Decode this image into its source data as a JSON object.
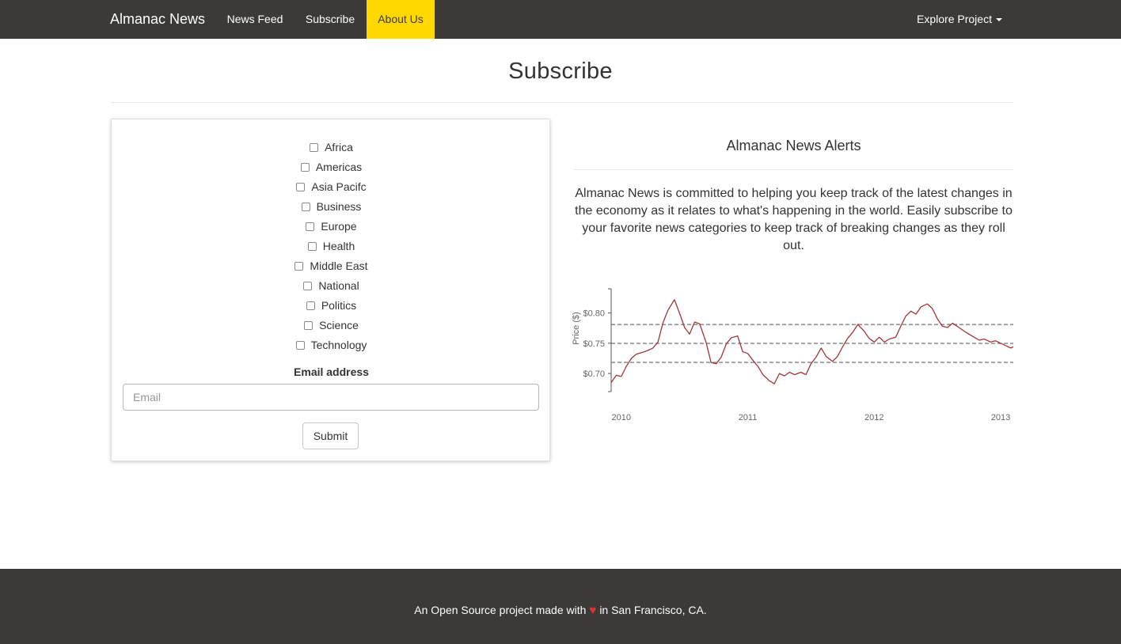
{
  "navbar": {
    "brand": "Almanac News",
    "links": [
      "News Feed",
      "Subscribe",
      "About Us"
    ],
    "explore": "Explore Project",
    "active_color": "#ffd800",
    "bg_color": "#3b3a37"
  },
  "page": {
    "title": "Subscribe"
  },
  "form": {
    "categories": [
      "Africa",
      "Americas",
      "Asia Pacifc",
      "Business",
      "Europe",
      "Health",
      "Middle East",
      "National",
      "Politics",
      "Science",
      "Technology"
    ],
    "checked": [
      false,
      false,
      false,
      false,
      false,
      false,
      false,
      false,
      false,
      false,
      false
    ],
    "email_label": "Email address",
    "email_placeholder": "Email",
    "email_value": "",
    "submit_label": "Submit"
  },
  "alerts": {
    "title": "Almanac News Alerts",
    "description": "Almanac News is committed to helping you keep track of the latest changes in the economy as it relates to what's happening in the world. Easily subscribe to your favorite news categories to keep track of breaking changes as they roll out."
  },
  "chart_data": {
    "type": "line",
    "title": "",
    "xlabel": "",
    "ylabel": "Price ($)",
    "x_ticks": [
      "2010",
      "2011",
      "2012",
      "2013"
    ],
    "y_ticks": [
      "$0.70",
      "$0.75",
      "$0.80"
    ],
    "ylim": [
      0.67,
      0.84
    ],
    "xlim": [
      2009.92,
      2013.1
    ],
    "line_color": "#a33636",
    "reference_lines": [
      0.7183,
      0.7497,
      0.7809
    ],
    "series": [
      {
        "x": [
          2009.92,
          2009.96,
          2010.0,
          2010.04,
          2010.08,
          2010.12,
          2010.17,
          2010.21,
          2010.25,
          2010.29,
          2010.33,
          2010.37,
          2010.42,
          2010.46,
          2010.5,
          2010.54,
          2010.58,
          2010.62,
          2010.67,
          2010.71,
          2010.75,
          2010.79,
          2010.83,
          2010.87,
          2010.92,
          2010.96,
          2011.0,
          2011.04,
          2011.08,
          2011.12,
          2011.17,
          2011.21,
          2011.25,
          2011.29,
          2011.33,
          2011.37,
          2011.42,
          2011.46,
          2011.5,
          2011.54,
          2011.58,
          2011.62,
          2011.67,
          2011.71,
          2011.75,
          2011.79,
          2011.83,
          2011.87,
          2011.92,
          2011.96,
          2012.0,
          2012.04,
          2012.08,
          2012.12,
          2012.17,
          2012.21,
          2012.25,
          2012.29,
          2012.33,
          2012.37,
          2012.42,
          2012.46,
          2012.5,
          2012.54,
          2012.58,
          2012.62,
          2012.67,
          2012.71,
          2012.75,
          2012.79,
          2012.83,
          2012.87,
          2012.92,
          2012.96,
          2013.0,
          2013.04,
          2013.08,
          2013.1
        ],
        "y": [
          0.685,
          0.697,
          0.695,
          0.712,
          0.725,
          0.732,
          0.735,
          0.738,
          0.742,
          0.752,
          0.784,
          0.805,
          0.822,
          0.8,
          0.776,
          0.765,
          0.785,
          0.782,
          0.752,
          0.718,
          0.716,
          0.727,
          0.749,
          0.759,
          0.762,
          0.736,
          0.733,
          0.722,
          0.712,
          0.698,
          0.688,
          0.683,
          0.7,
          0.696,
          0.702,
          0.698,
          0.702,
          0.698,
          0.716,
          0.727,
          0.742,
          0.728,
          0.72,
          0.728,
          0.744,
          0.758,
          0.768,
          0.781,
          0.77,
          0.758,
          0.752,
          0.76,
          0.752,
          0.757,
          0.76,
          0.778,
          0.795,
          0.803,
          0.798,
          0.81,
          0.815,
          0.807,
          0.79,
          0.778,
          0.776,
          0.783,
          0.776,
          0.77,
          0.765,
          0.76,
          0.755,
          0.757,
          0.752,
          0.754,
          0.75,
          0.746,
          0.742,
          0.744
        ]
      }
    ]
  },
  "footer": {
    "text_before": "An Open Source project made with",
    "heart_icon": "heart-icon",
    "text_after": "in San Francisco, CA."
  }
}
